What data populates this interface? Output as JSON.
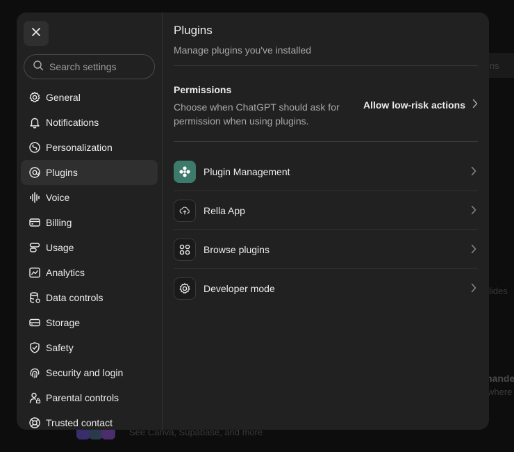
{
  "background": {
    "pill_label": "ins",
    "text_lides": "lides",
    "text_mande": "nande",
    "text_where": "where",
    "text_see": "See Canva, Supabase, and more"
  },
  "sidebar": {
    "search_placeholder": "Search settings",
    "items": [
      {
        "label": "General",
        "icon": "gear-icon"
      },
      {
        "label": "Notifications",
        "icon": "bell-icon"
      },
      {
        "label": "Personalization",
        "icon": "personalization-icon"
      },
      {
        "label": "Plugins",
        "icon": "plugins-icon",
        "active": true
      },
      {
        "label": "Voice",
        "icon": "voice-waveform-icon"
      },
      {
        "label": "Billing",
        "icon": "credit-card-icon"
      },
      {
        "label": "Usage",
        "icon": "usage-icon"
      },
      {
        "label": "Analytics",
        "icon": "analytics-chart-icon"
      },
      {
        "label": "Data controls",
        "icon": "database-icon"
      },
      {
        "label": "Storage",
        "icon": "storage-drive-icon"
      },
      {
        "label": "Safety",
        "icon": "shield-check-icon"
      },
      {
        "label": "Security and login",
        "icon": "fingerprint-icon"
      },
      {
        "label": "Parental controls",
        "icon": "parental-user-icon"
      },
      {
        "label": "Trusted contact",
        "icon": "lifebuoy-icon"
      }
    ]
  },
  "main": {
    "title": "Plugins",
    "subtitle": "Manage plugins you've installed",
    "permissions": {
      "title": "Permissions",
      "description": "Choose when ChatGPT should ask for permission when using plugins.",
      "action_label": "Allow low-risk actions"
    },
    "rows": [
      {
        "label": "Plugin Management",
        "icon": "plugin-management-icon"
      },
      {
        "label": "Rella App",
        "icon": "rella-app-icon"
      },
      {
        "label": "Browse plugins",
        "icon": "grid-icon"
      },
      {
        "label": "Developer mode",
        "icon": "gear-icon"
      }
    ]
  },
  "colors": {
    "modal_bg": "#212121",
    "active_item_bg": "#2f2f2f",
    "plugin_accent": "#3c7a6b"
  }
}
